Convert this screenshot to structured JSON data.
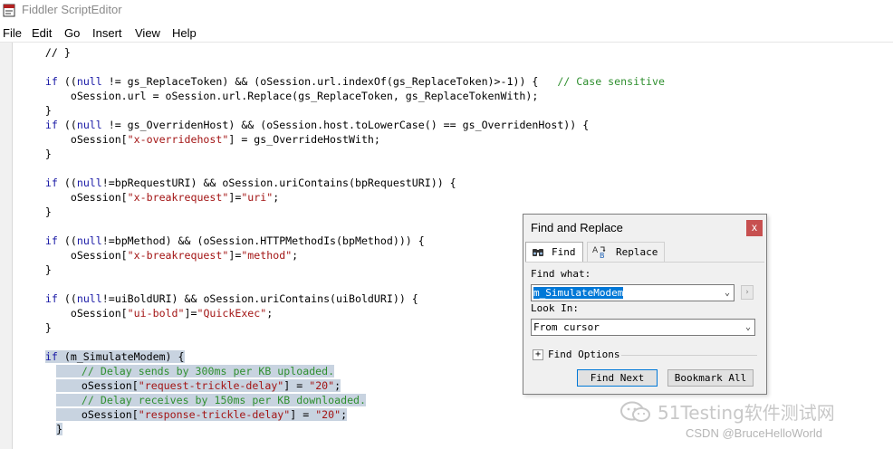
{
  "window": {
    "title": "Fiddler ScriptEditor"
  },
  "menu": [
    "File",
    "Edit",
    "Go",
    "Insert",
    "View",
    "Help"
  ],
  "code": [
    [
      {
        "t": "    // }",
        "c": "plain"
      }
    ],
    [],
    [
      {
        "t": "    ",
        "c": "plain"
      },
      {
        "t": "if",
        "c": "kw"
      },
      {
        "t": " ((",
        "c": "plain"
      },
      {
        "t": "null",
        "c": "kw"
      },
      {
        "t": " != gs_ReplaceToken) && (oSession.url.indexOf(gs_ReplaceToken)>-1)) {   ",
        "c": "plain"
      },
      {
        "t": "// Case sensitive",
        "c": "cmt"
      }
    ],
    [
      {
        "t": "        oSession.url = oSession.url.Replace(gs_ReplaceToken, gs_ReplaceTokenWith);",
        "c": "plain"
      }
    ],
    [
      {
        "t": "    }",
        "c": "plain"
      }
    ],
    [
      {
        "t": "    ",
        "c": "plain"
      },
      {
        "t": "if",
        "c": "kw"
      },
      {
        "t": " ((",
        "c": "plain"
      },
      {
        "t": "null",
        "c": "kw"
      },
      {
        "t": " != gs_OverridenHost) && (oSession.host.toLowerCase() == gs_OverridenHost)) {",
        "c": "plain"
      }
    ],
    [
      {
        "t": "        oSession[",
        "c": "plain"
      },
      {
        "t": "\"x-overridehost\"",
        "c": "str"
      },
      {
        "t": "] = gs_OverrideHostWith;",
        "c": "plain"
      }
    ],
    [
      {
        "t": "    }",
        "c": "plain"
      }
    ],
    [],
    [
      {
        "t": "    ",
        "c": "plain"
      },
      {
        "t": "if",
        "c": "kw"
      },
      {
        "t": " ((",
        "c": "plain"
      },
      {
        "t": "null",
        "c": "kw"
      },
      {
        "t": "!=bpRequestURI) && oSession.uriContains(bpRequestURI)) {",
        "c": "plain"
      }
    ],
    [
      {
        "t": "        oSession[",
        "c": "plain"
      },
      {
        "t": "\"x-breakrequest\"",
        "c": "str"
      },
      {
        "t": "]=",
        "c": "plain"
      },
      {
        "t": "\"uri\"",
        "c": "str"
      },
      {
        "t": ";",
        "c": "plain"
      }
    ],
    [
      {
        "t": "    }",
        "c": "plain"
      }
    ],
    [],
    [
      {
        "t": "    ",
        "c": "plain"
      },
      {
        "t": "if",
        "c": "kw"
      },
      {
        "t": " ((",
        "c": "plain"
      },
      {
        "t": "null",
        "c": "kw"
      },
      {
        "t": "!=bpMethod) && (oSession.HTTPMethodIs(bpMethod))) {",
        "c": "plain"
      }
    ],
    [
      {
        "t": "        oSession[",
        "c": "plain"
      },
      {
        "t": "\"x-breakrequest\"",
        "c": "str"
      },
      {
        "t": "]=",
        "c": "plain"
      },
      {
        "t": "\"method\"",
        "c": "str"
      },
      {
        "t": ";",
        "c": "plain"
      }
    ],
    [
      {
        "t": "    }",
        "c": "plain"
      }
    ],
    [],
    [
      {
        "t": "    ",
        "c": "plain"
      },
      {
        "t": "if",
        "c": "kw"
      },
      {
        "t": " ((",
        "c": "plain"
      },
      {
        "t": "null",
        "c": "kw"
      },
      {
        "t": "!=uiBoldURI) && oSession.uriContains(uiBoldURI)) {",
        "c": "plain"
      }
    ],
    [
      {
        "t": "        oSession[",
        "c": "plain"
      },
      {
        "t": "\"ui-bold\"",
        "c": "str"
      },
      {
        "t": "]=",
        "c": "plain"
      },
      {
        "t": "\"QuickExec\"",
        "c": "str"
      },
      {
        "t": ";",
        "c": "plain"
      }
    ],
    [
      {
        "t": "    }",
        "c": "plain"
      }
    ],
    [],
    [
      {
        "t": "    ",
        "c": "plain"
      },
      {
        "t": "if",
        "c": "kw",
        "s": 1
      },
      {
        "t": " (m_SimulateModem) {",
        "c": "plain",
        "s": 1
      }
    ],
    [
      {
        "t": "        // Delay sends by 300ms per KB uploaded.",
        "c": "cmt",
        "s": 1
      }
    ],
    [
      {
        "t": "        oSession[",
        "c": "plain",
        "s": 1
      },
      {
        "t": "\"request-trickle-delay\"",
        "c": "str",
        "s": 1
      },
      {
        "t": "] = ",
        "c": "plain",
        "s": 1
      },
      {
        "t": "\"20\"",
        "c": "str",
        "s": 1
      },
      {
        "t": ";",
        "c": "plain",
        "s": 1
      }
    ],
    [
      {
        "t": "        // Delay receives by 150ms per KB downloaded.",
        "c": "cmt",
        "s": 1
      }
    ],
    [
      {
        "t": "        oSession[",
        "c": "plain",
        "s": 1
      },
      {
        "t": "\"response-trickle-delay\"",
        "c": "str",
        "s": 1
      },
      {
        "t": "] = ",
        "c": "plain",
        "s": 1
      },
      {
        "t": "\"20\"",
        "c": "str",
        "s": 1
      },
      {
        "t": ";",
        "c": "plain",
        "s": 1
      }
    ],
    [
      {
        "t": "    }",
        "c": "plain",
        "s": 1
      }
    ]
  ],
  "dialog": {
    "title": "Find and Replace",
    "close": "x",
    "tabs": {
      "find": "Find",
      "replace": "Replace"
    },
    "find_what_label": "Find what:",
    "find_what_value": "m_SimulateModem",
    "look_in_label": "Look In:",
    "look_in_value": "From cursor",
    "find_options_label": "Find Options",
    "find_next": "Find Next",
    "bookmark_all": "Bookmark All"
  },
  "watermark": {
    "main": "51Testing软件测试网",
    "sub": "CSDN @BruceHelloWorld"
  },
  "colors": {
    "keyword": "#1a1aa6",
    "string": "#a31515",
    "comment": "#2f8f2f",
    "selection": "#c8d3e0",
    "close_button": "#c75050"
  }
}
